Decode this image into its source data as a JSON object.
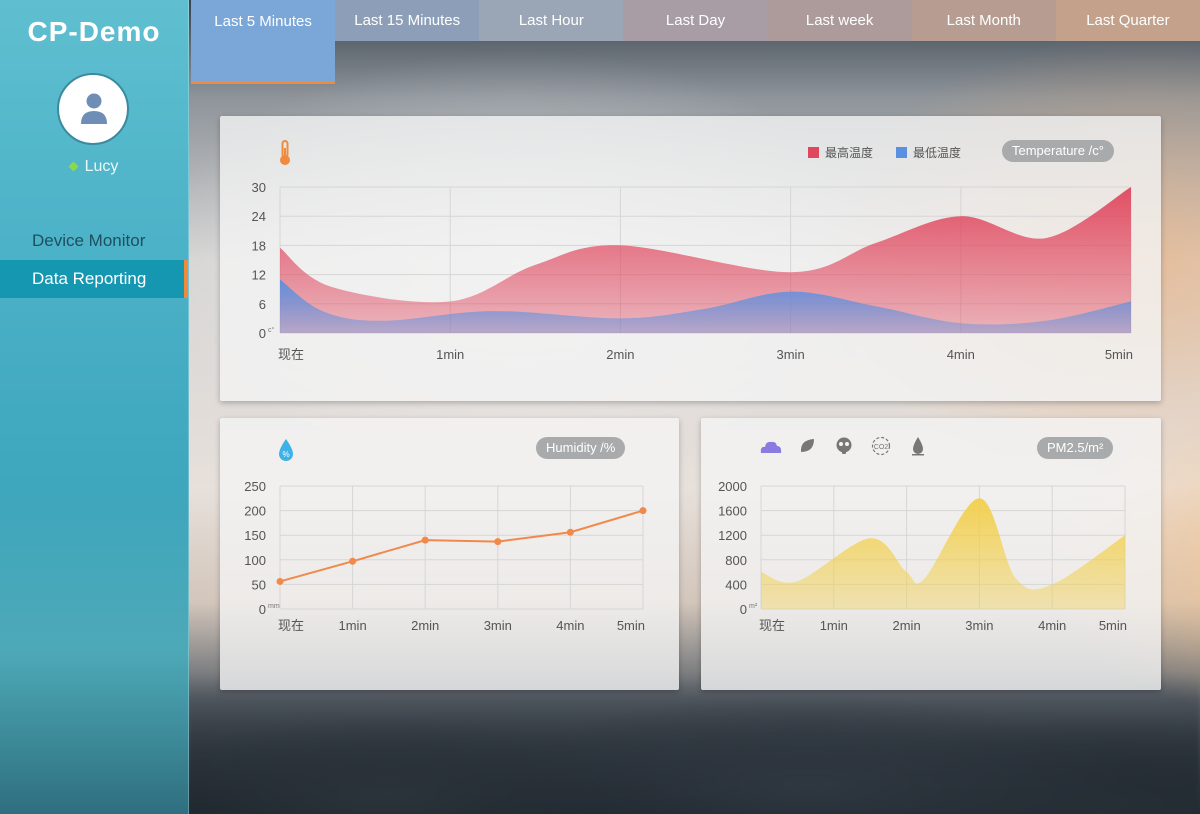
{
  "sidebar": {
    "brand": "CP-Demo",
    "user": "Lucy",
    "nav": [
      {
        "label": "Device Monitor"
      },
      {
        "label": "Data Reporting"
      }
    ]
  },
  "tabs": [
    {
      "label": "Last 5 Minutes",
      "color": "#7aa6d8"
    },
    {
      "label": "Last 15 Minutes",
      "color": "#8d9fb8"
    },
    {
      "label": "Last Hour",
      "color": "#9aa6b6"
    },
    {
      "label": "Last Day",
      "color": "#a89da4"
    },
    {
      "label": "Last week",
      "color": "#ad9b9b"
    },
    {
      "label": "Last Month",
      "color": "#b79d91"
    },
    {
      "label": "Last Quarter",
      "color": "#c3a18b"
    }
  ],
  "temperature": {
    "title": "Temperature /c°",
    "icon": "thermometer-icon",
    "legend": [
      {
        "name": "最高温度",
        "color": "#e0475e"
      },
      {
        "name": "最低温度",
        "color": "#5b90e0"
      }
    ]
  },
  "humidity": {
    "title": "Humidity /%",
    "icon": "humidity-drop-icon"
  },
  "pm": {
    "title": "PM2.5/m²",
    "icons": [
      "weather-cloud-icon",
      "leaf-icon",
      "gas-mask-icon",
      "co2-icon",
      "water-drop-icon"
    ]
  },
  "chart_data": [
    {
      "type": "area",
      "title": "Temperature /c°",
      "x": [
        "现在",
        "1min",
        "2min",
        "3min",
        "4min",
        "5min"
      ],
      "y_unit": "c°",
      "ylim": [
        0,
        30
      ],
      "yticks": [
        0,
        6,
        12,
        18,
        24,
        30
      ],
      "grid": true,
      "legend_position": "top-right",
      "series": [
        {
          "name": "最高温度",
          "color": "#e0475e",
          "points": [
            [
              0,
              17.5
            ],
            [
              0.3,
              9.5
            ],
            [
              1,
              6.5
            ],
            [
              1.5,
              14
            ],
            [
              2,
              18
            ],
            [
              3,
              12.5
            ],
            [
              3.5,
              18.5
            ],
            [
              4,
              24
            ],
            [
              4.5,
              19.5
            ],
            [
              5,
              30
            ]
          ]
        },
        {
          "name": "最低温度",
          "color": "#5b90e0",
          "points": [
            [
              0,
              11
            ],
            [
              0.25,
              4.5
            ],
            [
              0.6,
              2.5
            ],
            [
              1.25,
              4.5
            ],
            [
              2,
              3
            ],
            [
              2.5,
              5
            ],
            [
              3,
              8.5
            ],
            [
              3.5,
              5.5
            ],
            [
              4,
              2
            ],
            [
              4.5,
              2.5
            ],
            [
              5,
              6.5
            ]
          ]
        }
      ]
    },
    {
      "type": "line",
      "title": "Humidity /%",
      "x": [
        "现在",
        "1min",
        "2min",
        "3min",
        "4min",
        "5min"
      ],
      "y_unit": "mm",
      "ylim": [
        0,
        250
      ],
      "yticks": [
        0,
        50,
        100,
        150,
        200,
        250
      ],
      "grid": true,
      "series": [
        {
          "name": "",
          "color": "#f0894a",
          "values": [
            56,
            97,
            140,
            137,
            156,
            200
          ]
        }
      ]
    },
    {
      "type": "area",
      "title": "PM2.5/m²",
      "x": [
        "现在",
        "1min",
        "2min",
        "3min",
        "4min",
        "5min"
      ],
      "y_unit": "m²",
      "ylim": [
        0,
        2000
      ],
      "yticks": [
        0,
        400,
        800,
        1200,
        1600,
        2000
      ],
      "grid": true,
      "series": [
        {
          "name": "",
          "color": "#f2cf4a",
          "points": [
            [
              0,
              600
            ],
            [
              0.5,
              450
            ],
            [
              1.5,
              1150
            ],
            [
              2,
              600
            ],
            [
              2.25,
              500
            ],
            [
              3,
              1800
            ],
            [
              3.5,
              500
            ],
            [
              4,
              400
            ],
            [
              5,
              1200
            ]
          ]
        }
      ]
    }
  ]
}
